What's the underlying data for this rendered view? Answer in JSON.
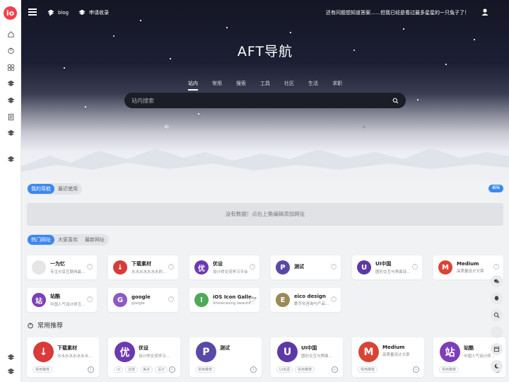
{
  "brand": {
    "logo_text": "io",
    "accent": "#f1404b",
    "link_color": "#3d87f0"
  },
  "sidebar": {
    "icons": [
      "home-icon",
      "timer-icon",
      "grid-icon",
      "layers-icon",
      "layers-icon",
      "document-icon",
      "layers-icon",
      "layers-icon",
      "layers-icon",
      "layers-icon"
    ]
  },
  "header": {
    "menu_icon": "menu-icon",
    "links": [
      {
        "label": "blog"
      },
      {
        "label": "申请收录"
      }
    ],
    "marquee": "还有问题想知道答案……但我已经是看过最多星星的一只兔子了！",
    "user_icon": "user-icon"
  },
  "hero": {
    "title": "AFT导航",
    "tabs": [
      "站内",
      "常用",
      "搜索",
      "工具",
      "社区",
      "生活",
      "求职"
    ],
    "active_tab": "站内",
    "search_placeholder": "站内搜索"
  },
  "my_nav": {
    "tabs": [
      "我的导航",
      "最近使用"
    ],
    "active": "我的导航",
    "edit_label": "编辑",
    "empty_text": "没有数据！点右上角编辑添加网址"
  },
  "hot": {
    "tabs": [
      "热门网址",
      "大家喜欢",
      "最新网址"
    ],
    "active": "热门网址",
    "cards": [
      {
        "name": "一为忆",
        "desc": "专注分享互联网最…",
        "color": "#e5e5e5",
        "glyph": ""
      },
      {
        "name": "下载素材",
        "desc": "水水水水水水水的…",
        "color": "#d93a3a",
        "glyph": "↓"
      },
      {
        "name": "优设",
        "desc": "设计师交流学习平台",
        "color": "#6a3ab0",
        "glyph": "优"
      },
      {
        "name": "测试",
        "desc": "",
        "color": "#5a48a8",
        "glyph": "P"
      },
      {
        "name": "UI中国",
        "desc": "图形交互与界面设…",
        "color": "#5b3aa6",
        "glyph": "U"
      },
      {
        "name": "Medium",
        "desc": "高质量设计文章",
        "color": "#d84436",
        "glyph": "M"
      },
      {
        "name": "站酷",
        "desc": "中国人气设计师互…",
        "color": "#7d3fb8",
        "glyph": "站"
      },
      {
        "name": "google",
        "desc": "google",
        "color": "#8e5ac0",
        "glyph": "G"
      },
      {
        "name": "iOS Icon Gallery",
        "desc": "Showcasing beautif…",
        "color": "#4caa5a",
        "glyph": "I"
      },
      {
        "name": "eico design",
        "desc": "数字化咨询与产品…",
        "color": "#9a8a55",
        "glyph": "E"
      }
    ]
  },
  "common": {
    "title": "常用推荐",
    "cards": [
      {
        "name": "下载素材",
        "desc": "水水水水水水水水…",
        "color": "#d93a3a",
        "glyph": "↓",
        "tags": [
          "常用推荐"
        ]
      },
      {
        "name": "优设",
        "desc": "设计师交流学习…",
        "color": "#6a3ab0",
        "glyph": "优",
        "tags": [
          "UI",
          "创意",
          "美术",
          "设计"
        ]
      },
      {
        "name": "测试",
        "desc": "",
        "color": "#5a48a8",
        "glyph": "P",
        "tags": [
          "常用推荐"
        ]
      },
      {
        "name": "UI中国",
        "desc": "图形交互与界面…",
        "color": "#5b3aa6",
        "glyph": "U",
        "tags": [
          "UI资源",
          "常用推荐"
        ]
      },
      {
        "name": "Medium",
        "desc": "高质量设计文章",
        "color": "#d84436",
        "glyph": "M",
        "tags": [
          "常用推荐"
        ]
      },
      {
        "name": "站酷",
        "desc": "中国人气设计师…",
        "color": "#7d3fb8",
        "glyph": "站",
        "tags": [
          "常用推荐"
        ]
      }
    ]
  },
  "float_buttons": [
    "wechat-icon",
    "qq-icon",
    "search-icon",
    "circle-icon",
    "calendar-icon",
    "moon-icon"
  ]
}
